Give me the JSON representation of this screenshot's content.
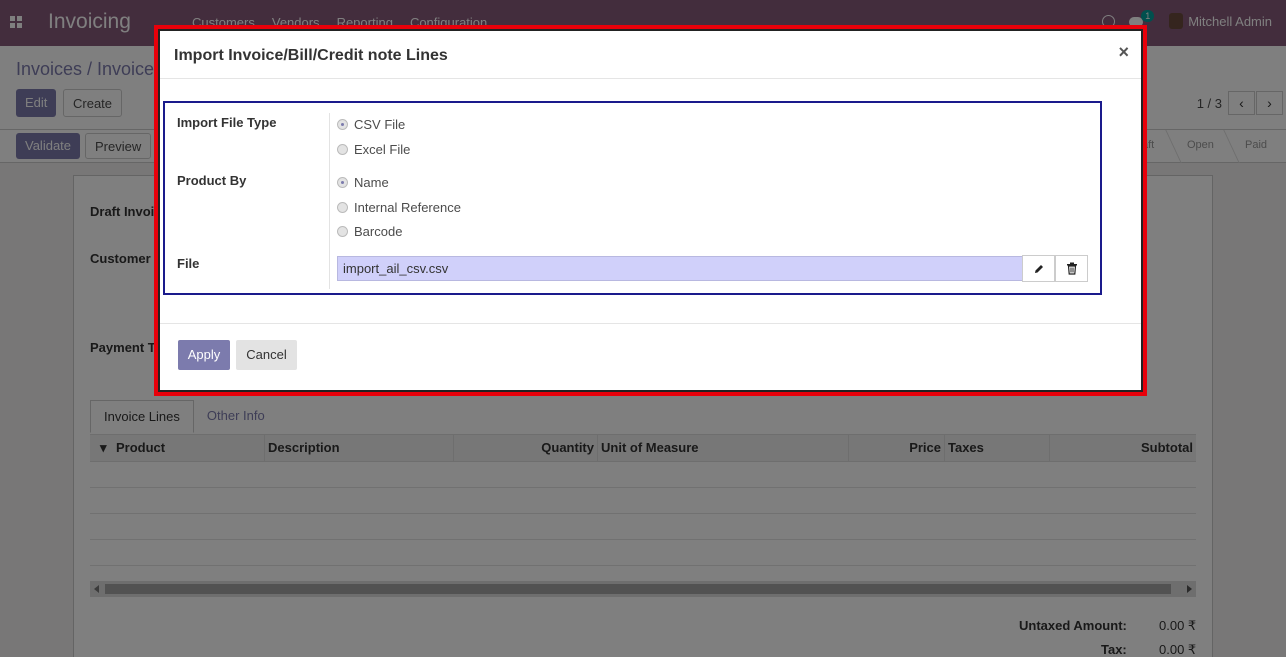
{
  "navbar": {
    "app_title": "Invoicing",
    "menu": [
      "Customers",
      "Vendors",
      "Reporting",
      "Configuration"
    ],
    "message_count": "1",
    "user_name": "Mitchell Admin",
    "bg_color": "#875a7b"
  },
  "control": {
    "breadcrumb": "Invoices / Invoice",
    "edit_label": "Edit",
    "create_label": "Create",
    "pager": "1 / 3"
  },
  "statusbar": {
    "validate_label": "Validate",
    "preview_label": "Preview",
    "stages": [
      "aft",
      "Open",
      "Paid"
    ]
  },
  "sheet": {
    "draft_label": "Draft Invoic",
    "customer_label": "Customer",
    "payment_label": "Payment Te",
    "tabs": [
      "Invoice Lines",
      "Other Info"
    ],
    "columns": [
      "Product",
      "Description",
      "Quantity",
      "Unit of Measure",
      "Price",
      "Taxes",
      "Subtotal"
    ],
    "untaxed_label": "Untaxed Amount:",
    "untaxed_value": "0.00 ₹",
    "tax_label": "Tax:",
    "tax_value": "0.00 ₹"
  },
  "modal": {
    "title": "Import Invoice/Bill/Credit note Lines",
    "close_symbol": "×",
    "import_type_label": "Import File Type",
    "import_type_options": [
      "CSV File",
      "Excel File"
    ],
    "import_type_selected": "CSV File",
    "product_by_label": "Product By",
    "product_by_options": [
      "Name",
      "Internal Reference",
      "Barcode"
    ],
    "product_by_selected": "Name",
    "file_label": "File",
    "file_value": "import_ail_csv.csv",
    "apply_label": "Apply",
    "cancel_label": "Cancel",
    "accent_color": "#7c7bad",
    "highlight_color": "#e8000a"
  }
}
